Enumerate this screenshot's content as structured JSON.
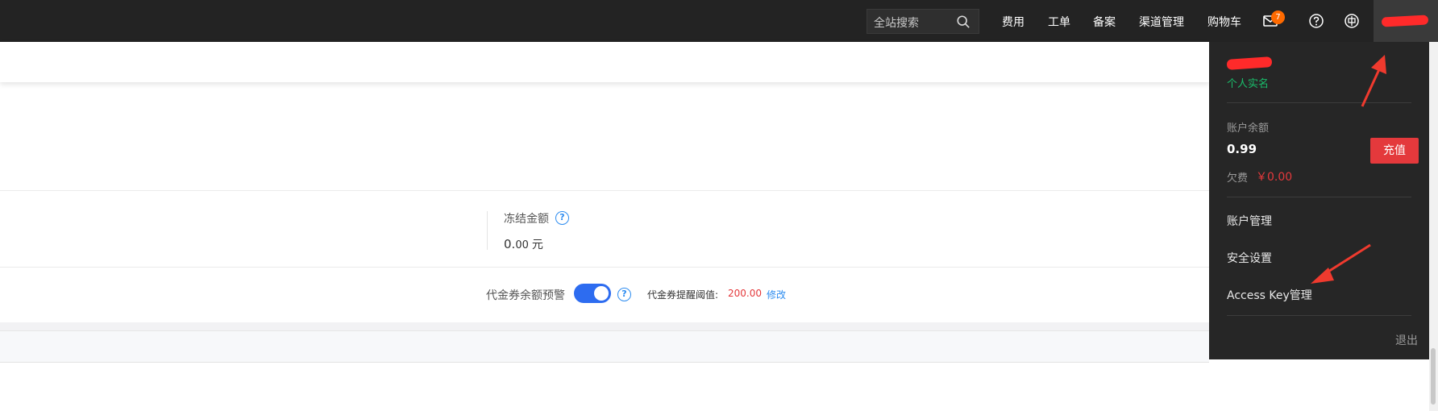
{
  "topbar": {
    "search_placeholder": "全站搜索",
    "nav": [
      "费用",
      "工单",
      "备案",
      "渠道管理",
      "购物车"
    ],
    "message_count": "7",
    "accent_color": "#ff6a00"
  },
  "summary": {
    "frozen_label": "冻结金额",
    "frozen_amount": "0.",
    "frozen_amount_decimal": "00",
    "frozen_unit": "元"
  },
  "coupon": {
    "alert_label": "代金券余额预警",
    "alert_enabled": true,
    "threshold_label": "代金券提醒阈值:",
    "threshold_value": "200.00",
    "modify_link": "修改"
  },
  "account_menu": {
    "verification": "个人实名",
    "balance_label": "账户余额",
    "balance": "0.99",
    "recharge_button": "充值",
    "owed_label": "欠费",
    "owed_value": "￥0.00",
    "items": [
      "账户管理",
      "安全设置",
      "Access Key管理"
    ],
    "logout": "退出"
  }
}
